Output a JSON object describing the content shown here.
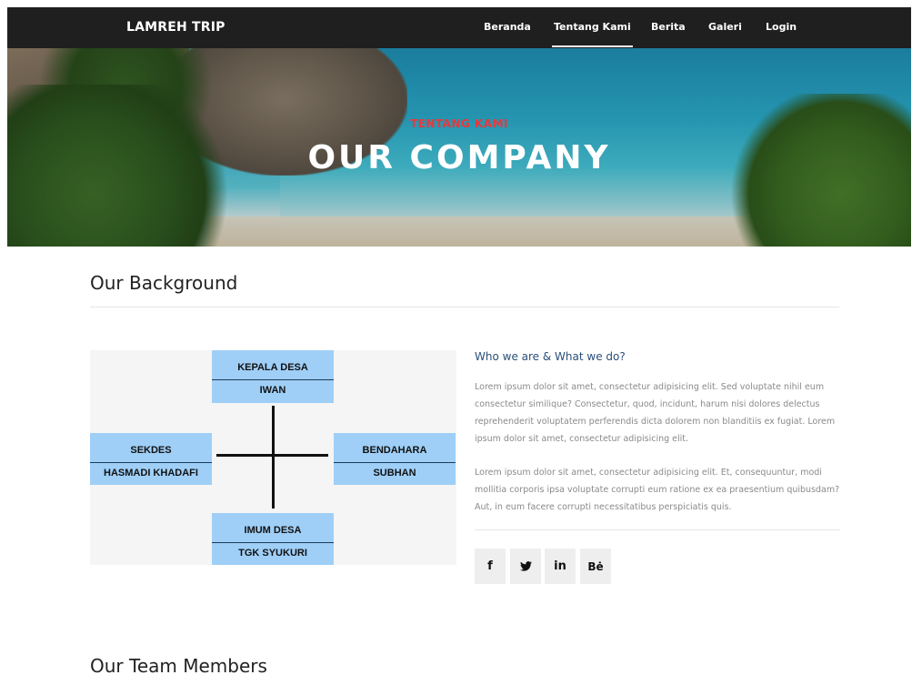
{
  "nav": {
    "brand": "LAMREH TRIP",
    "items": [
      {
        "label": "Beranda"
      },
      {
        "label": "Tentang Kami",
        "active": true
      },
      {
        "label": "Berita"
      },
      {
        "label": "Galeri"
      },
      {
        "label": "Login"
      }
    ]
  },
  "hero": {
    "subtitle": "TENTANG KAMI",
    "title": "OUR COMPANY"
  },
  "background_section": {
    "title": "Our Background",
    "org_chart": {
      "top": {
        "role": "KEPALA DESA",
        "name": "IWAN"
      },
      "left": {
        "role": "SEKDES",
        "name": "HASMADI KHADAFI"
      },
      "right": {
        "role": "BENDAHARA",
        "name": "SUBHAN"
      },
      "bottom": {
        "role": "IMUM DESA",
        "name": "TGK SYUKURI"
      }
    },
    "who_title": "Who we are & What we do?",
    "paragraph1": "Lorem ipsum dolor sit amet, consectetur adipisicing elit. Sed voluptate nihil eum consectetur similique? Consectetur, quod, incidunt, harum nisi dolores delectus reprehenderit voluptatem perferendis dicta dolorem non blanditiis ex fugiat. Lorem ipsum dolor sit amet, consectetur adipisicing elit.",
    "paragraph2": "Lorem ipsum dolor sit amet, consectetur adipisicing elit. Et, consequuntur, modi mollitia corporis ipsa voluptate corrupti eum ratione ex ea praesentium quibusdam? Aut, in eum facere corrupti necessitatibus perspiciatis quis.",
    "social": [
      {
        "icon": "facebook-icon",
        "glyph": "f"
      },
      {
        "icon": "twitter-icon",
        "glyph": "❦"
      },
      {
        "icon": "linkedin-icon",
        "glyph": "in"
      },
      {
        "icon": "behance-icon",
        "glyph": "Bė"
      }
    ]
  },
  "team_section": {
    "title": "Our Team Members"
  }
}
